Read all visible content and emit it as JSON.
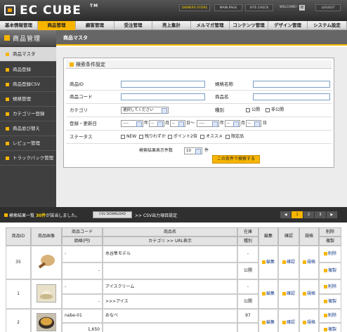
{
  "logo": {
    "text": "EC CUBE",
    "tm": "TM"
  },
  "topbar": {
    "owners_store": "OWNERS STORE",
    "main_page": "MAIN PAGE",
    "site_check": "SITE CHECK",
    "welcome": "WELCOME!",
    "user": "様",
    "logout": "LOGOUT"
  },
  "gnav": [
    "基本情報管理",
    "商品管理",
    "顧客管理",
    "受注管理",
    "売上集計",
    "メルマガ管理",
    "コンテンツ管理",
    "デザイン管理",
    "システム設定"
  ],
  "subhead": {
    "title": "商品管理"
  },
  "page": {
    "title": "商品マスタ"
  },
  "sidebar": [
    "商品マスタ",
    "商品登録",
    "商品登録CSV",
    "規格管理",
    "カテゴリー登録",
    "商品並び替え",
    "レビュー管理",
    "トラックバック管理"
  ],
  "search": {
    "title": "検索条件設定",
    "product_id": "商品ID",
    "spec_name": "規格名称",
    "product_code": "商品コード",
    "product_name": "商品名",
    "category": "カテゴリ",
    "category_select": "選択してください",
    "kind": "種別",
    "public": "公開",
    "private": "非公開",
    "date": "登録・更新日",
    "year_ph": "----",
    "month_ph": "--",
    "year": "年",
    "month": "月",
    "day": "日",
    "tilde": "〜",
    "status": "ステータス",
    "statuses": [
      "NEW",
      "残りわずか",
      "ポイント2倍",
      "オススメ",
      "限定品"
    ],
    "display_count_label": "検索結果表示件数",
    "display_count": "10",
    "count_unit": "件",
    "button": "この条件で検索する"
  },
  "results": {
    "label": "検索結果一覧",
    "count": "30件",
    "suffix": "が該当しました。",
    "csv_download": "CSV DOWNLOAD",
    "csv_setting": ">> CSV出力項目設定",
    "pages": [
      "◀",
      "1",
      "2",
      "3",
      "▶"
    ],
    "current_page": "1"
  },
  "table": {
    "headers": {
      "id": "商品ID",
      "image": "商品画像",
      "code": "商品コード",
      "price": "価格(円)",
      "name": "商品名",
      "category_url": "カテゴリ >> URL表示",
      "stock": "在庫",
      "kind": "種別",
      "edit": "編集",
      "confirm": "確認",
      "spec": "規格",
      "delete": "削除",
      "copy": "複製"
    },
    "rows": [
      {
        "id": "35",
        "code": "-",
        "price": "-",
        "name": "水谷隼モデル",
        "category": "",
        "stock": "-",
        "kind": "公開",
        "edit": "編集",
        "confirm": "確認",
        "spec": "規格",
        "delete": "削除",
        "copy": "複製"
      },
      {
        "id": "1",
        "code": "-",
        "price": "-",
        "name": "アイスクリーム",
        "category": ">>>アイス",
        "stock": "-",
        "kind": "公開",
        "edit": "編集",
        "confirm": "確認",
        "spec": "規格",
        "delete": "削除",
        "copy": "複製"
      },
      {
        "id": "2",
        "code": "nabe-01",
        "price": "1,650",
        "name": "おなべ",
        "category": "",
        "stock": "97",
        "kind": "",
        "edit": "編集",
        "confirm": "確認",
        "spec": "規格",
        "delete": "削除",
        "copy": "複製"
      }
    ]
  }
}
